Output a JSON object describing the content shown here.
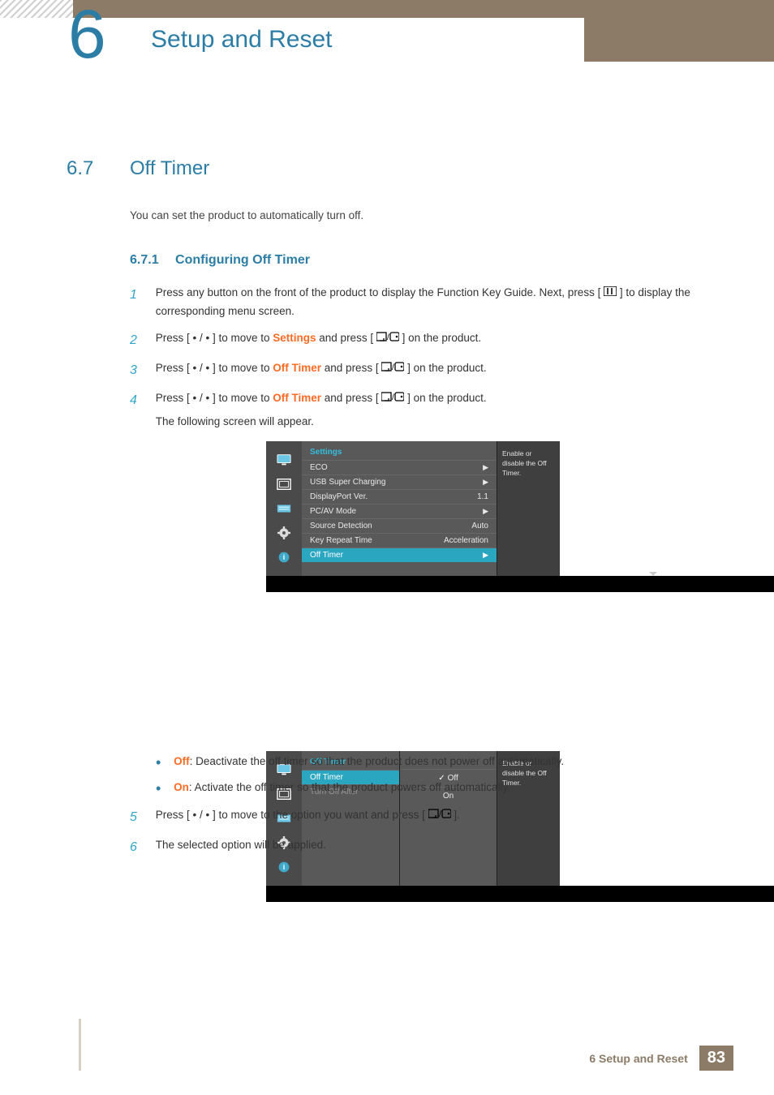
{
  "chapter": {
    "number": "6",
    "title": "Setup and Reset"
  },
  "section": {
    "number": "6.7",
    "title": "Off Timer"
  },
  "intro": "You can set the product to automatically turn off.",
  "subsection": {
    "number": "6.7.1",
    "title": "Configuring Off Timer"
  },
  "steps": {
    "s1": {
      "n": "1",
      "a": "Press any button on the front of the product to display the Function Key Guide. Next, press [ ",
      "b": " ] to display the corresponding menu screen."
    },
    "s2": {
      "n": "2",
      "pre": "Press [ • / • ] to move to ",
      "kw": "Settings",
      "mid": " and press [",
      "post": "] on the product."
    },
    "s3": {
      "n": "3",
      "pre": "Press [ • / • ] to move to ",
      "kw": "Off Timer",
      "mid": " and press [",
      "post": "] on the product."
    },
    "s4": {
      "n": "4",
      "pre": "Press [ • / • ] to move to ",
      "kw": "Off Timer",
      "mid": " and press [",
      "post": "] on the product.",
      "follow": "The following screen will appear."
    },
    "s5": {
      "n": "5",
      "pre": "Press [ • / • ] to move to the option you want and press [",
      "post": "]."
    },
    "s6": {
      "n": "6",
      "text": "The selected option will be applied."
    }
  },
  "panel1": {
    "title": "Settings",
    "rows": [
      {
        "label": "ECO",
        "value": "",
        "arrow": true
      },
      {
        "label": "USB Super Charging",
        "value": "",
        "arrow": true
      },
      {
        "label": "DisplayPort Ver.",
        "value": "1.1",
        "arrow": false
      },
      {
        "label": "PC/AV Mode",
        "value": "",
        "arrow": true
      },
      {
        "label": "Source Detection",
        "value": "Auto",
        "arrow": false
      },
      {
        "label": "Key Repeat Time",
        "value": "Acceleration",
        "arrow": false
      },
      {
        "label": "Off Timer",
        "value": "",
        "arrow": true,
        "selected": true
      }
    ],
    "help": "Enable or disable the Off Timer."
  },
  "panel2": {
    "title": "Off Timer",
    "rows": [
      {
        "label": "Off Timer",
        "selected": true
      },
      {
        "label": "Turn Off After",
        "dim": true
      }
    ],
    "options": [
      {
        "label": "Off",
        "checked": true
      },
      {
        "label": "On",
        "checked": false
      }
    ],
    "help": "Enable or disable the Off Timer."
  },
  "bullets": {
    "b1": {
      "kw": "Off",
      "text": ": Deactivate the off timer so that the product does not power off automatically."
    },
    "b2": {
      "kw": "On",
      "text": ": Activate the off timer so that the product powers off automatically."
    }
  },
  "footer": {
    "text": "6 Setup and Reset",
    "page": "83"
  }
}
